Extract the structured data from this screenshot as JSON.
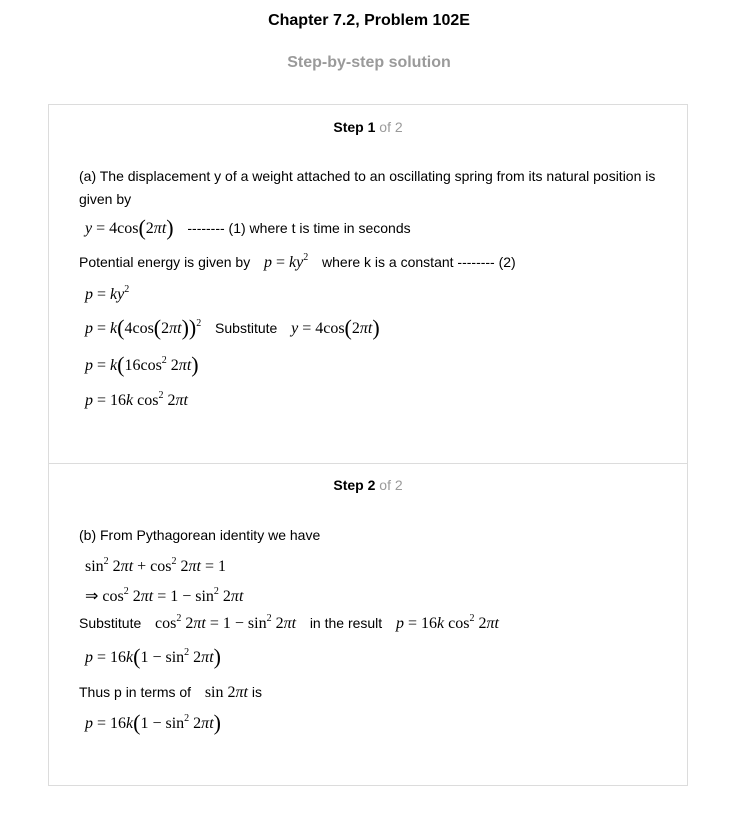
{
  "header": {
    "title": "Chapter 7.2, Problem 102E",
    "subtitle": "Step-by-step solution"
  },
  "steps": [
    {
      "step_label": "Step",
      "step_num": "1",
      "of_text": "of 2",
      "intro": "(a) The displacement y of a weight attached to an oscillating spring from its natural position is given by",
      "eq1_note": "-------- (1) where t is time in seconds",
      "pe_text": "Potential energy is given by",
      "pe_note": "where k is a constant -------- (2)",
      "substitute_label": "Substitute"
    },
    {
      "step_label": "Step",
      "step_num": "2",
      "of_text": "of 2",
      "intro": "(b) From Pythagorean identity we have",
      "substitute_label": "Substitute",
      "in_result_label": "in the result",
      "thus_text": "Thus p in terms of",
      "is_text": "is"
    }
  ]
}
